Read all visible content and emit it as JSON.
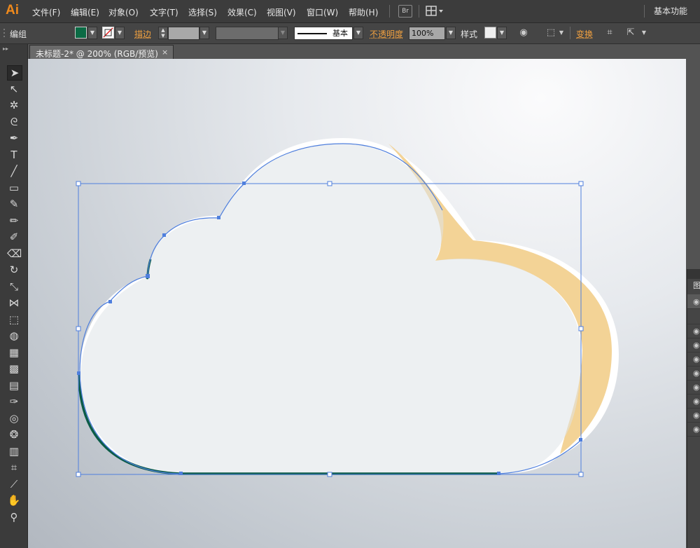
{
  "menubar": {
    "app_logo": "Ai",
    "items": [
      "文件(F)",
      "编辑(E)",
      "对象(O)",
      "文字(T)",
      "选择(S)",
      "效果(C)",
      "视图(V)",
      "窗口(W)",
      "帮助(H)"
    ],
    "bridge_label": "Br",
    "workspace": "基本功能"
  },
  "control": {
    "selection_type": "编组",
    "fill_color": "#0b6b45",
    "stroke_label": "描边",
    "stroke_profile_label": "基本",
    "opacity_label": "不透明度",
    "opacity_value": "100%",
    "style_label": "样式",
    "transform_label": "变换"
  },
  "document": {
    "tab_title": "未标题-2* @ 200% (RGB/预览)",
    "close_glyph": "×"
  },
  "tools": [
    {
      "name": "selection-tool",
      "glyph": "➤"
    },
    {
      "name": "direct-selection-tool",
      "glyph": "↖"
    },
    {
      "name": "magic-wand-tool",
      "glyph": "✲"
    },
    {
      "name": "lasso-tool",
      "glyph": "ᘓ"
    },
    {
      "name": "pen-tool",
      "glyph": "✒"
    },
    {
      "name": "type-tool",
      "glyph": "T"
    },
    {
      "name": "line-segment-tool",
      "glyph": "╱"
    },
    {
      "name": "rectangle-tool",
      "glyph": "▭"
    },
    {
      "name": "paintbrush-tool",
      "glyph": "✎"
    },
    {
      "name": "pencil-tool",
      "glyph": "✏"
    },
    {
      "name": "blob-brush-tool",
      "glyph": "✐"
    },
    {
      "name": "eraser-tool",
      "glyph": "⌫"
    },
    {
      "name": "rotate-tool",
      "glyph": "↻"
    },
    {
      "name": "scale-tool",
      "glyph": "⤡"
    },
    {
      "name": "width-tool",
      "glyph": "⋈"
    },
    {
      "name": "free-transform-tool",
      "glyph": "⬚"
    },
    {
      "name": "shape-builder-tool",
      "glyph": "◍"
    },
    {
      "name": "perspective-grid-tool",
      "glyph": "▦"
    },
    {
      "name": "mesh-tool",
      "glyph": "▩"
    },
    {
      "name": "gradient-tool",
      "glyph": "▤"
    },
    {
      "name": "eyedropper-tool",
      "glyph": "✑"
    },
    {
      "name": "blend-tool",
      "glyph": "◎"
    },
    {
      "name": "symbol-sprayer-tool",
      "glyph": "❂"
    },
    {
      "name": "column-graph-tool",
      "glyph": "▥"
    },
    {
      "name": "artboard-tool",
      "glyph": "⌗"
    },
    {
      "name": "slice-tool",
      "glyph": "⟋"
    },
    {
      "name": "hand-tool",
      "glyph": "✋"
    },
    {
      "name": "zoom-tool",
      "glyph": "⚲"
    }
  ],
  "layers_panel": {
    "tab_label": "图"
  }
}
